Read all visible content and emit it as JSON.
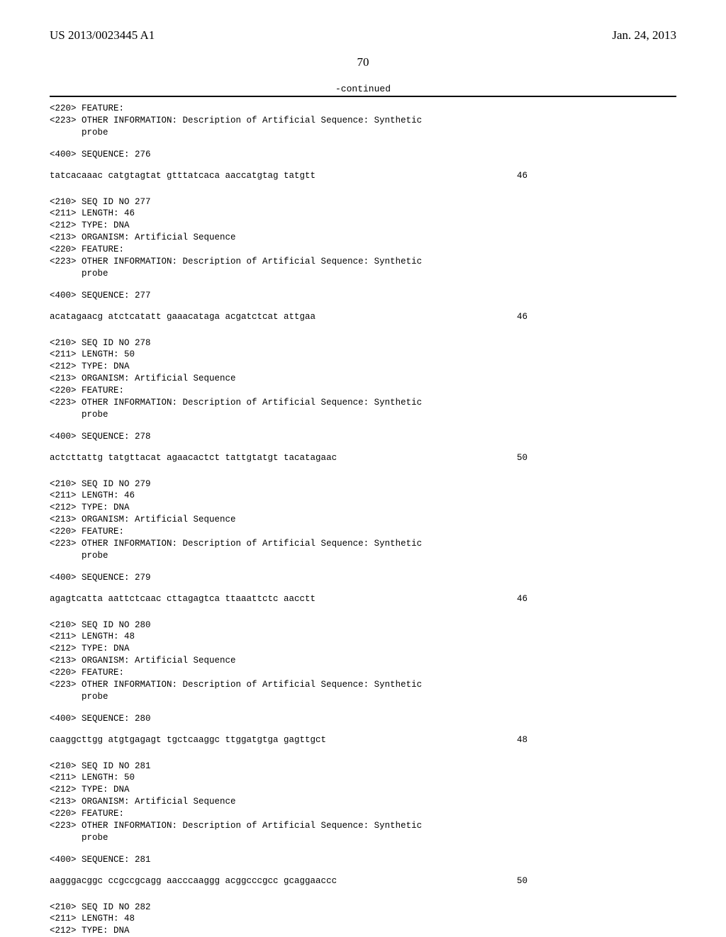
{
  "header": {
    "pub_number": "US 2013/0023445 A1",
    "pub_date": "Jan. 24, 2013"
  },
  "page_number": "70",
  "continued_label": "-continued",
  "blocks": [
    {
      "meta": "<220> FEATURE:\n<223> OTHER INFORMATION: Description of Artificial Sequence: Synthetic\n      probe",
      "seq_header": "<400> SEQUENCE: 276",
      "seq_text": "tatcacaaac catgtagtat gtttatcaca aaccatgtag tatgtt",
      "seq_len": "46"
    },
    {
      "meta": "<210> SEQ ID NO 277\n<211> LENGTH: 46\n<212> TYPE: DNA\n<213> ORGANISM: Artificial Sequence\n<220> FEATURE:\n<223> OTHER INFORMATION: Description of Artificial Sequence: Synthetic\n      probe",
      "seq_header": "<400> SEQUENCE: 277",
      "seq_text": "acatagaacg atctcatatt gaaacataga acgatctcat attgaa",
      "seq_len": "46"
    },
    {
      "meta": "<210> SEQ ID NO 278\n<211> LENGTH: 50\n<212> TYPE: DNA\n<213> ORGANISM: Artificial Sequence\n<220> FEATURE:\n<223> OTHER INFORMATION: Description of Artificial Sequence: Synthetic\n      probe",
      "seq_header": "<400> SEQUENCE: 278",
      "seq_text": "actcttattg tatgttacat agaacactct tattgtatgt tacatagaac",
      "seq_len": "50"
    },
    {
      "meta": "<210> SEQ ID NO 279\n<211> LENGTH: 46\n<212> TYPE: DNA\n<213> ORGANISM: Artificial Sequence\n<220> FEATURE:\n<223> OTHER INFORMATION: Description of Artificial Sequence: Synthetic\n      probe",
      "seq_header": "<400> SEQUENCE: 279",
      "seq_text": "agagtcatta aattctcaac cttagagtca ttaaattctc aacctt",
      "seq_len": "46"
    },
    {
      "meta": "<210> SEQ ID NO 280\n<211> LENGTH: 48\n<212> TYPE: DNA\n<213> ORGANISM: Artificial Sequence\n<220> FEATURE:\n<223> OTHER INFORMATION: Description of Artificial Sequence: Synthetic\n      probe",
      "seq_header": "<400> SEQUENCE: 280",
      "seq_text": "caaggcttgg atgtgagagt tgctcaaggc ttggatgtga gagttgct",
      "seq_len": "48"
    },
    {
      "meta": "<210> SEQ ID NO 281\n<211> LENGTH: 50\n<212> TYPE: DNA\n<213> ORGANISM: Artificial Sequence\n<220> FEATURE:\n<223> OTHER INFORMATION: Description of Artificial Sequence: Synthetic\n      probe",
      "seq_header": "<400> SEQUENCE: 281",
      "seq_text": "aagggacggc ccgccgcagg aacccaaggg acggcccgcc gcaggaaccc",
      "seq_len": "50"
    },
    {
      "meta": "<210> SEQ ID NO 282\n<211> LENGTH: 48\n<212> TYPE: DNA",
      "seq_header": "",
      "seq_text": "",
      "seq_len": ""
    }
  ]
}
